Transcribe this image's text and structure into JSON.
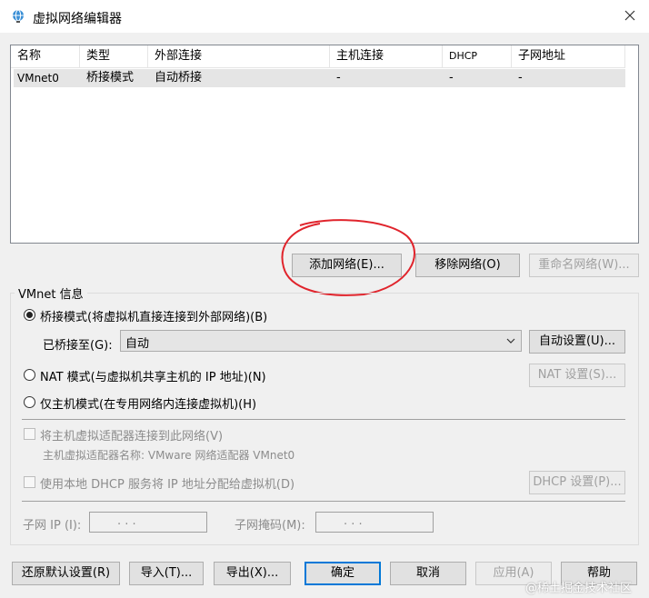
{
  "window": {
    "title": "虚拟网络编辑器"
  },
  "table": {
    "columns": [
      "名称",
      "类型",
      "外部连接",
      "主机连接",
      "DHCP",
      "子网地址"
    ],
    "rows": [
      [
        "VMnet0",
        "桥接模式",
        "自动桥接",
        "-",
        "-",
        "-"
      ]
    ]
  },
  "net_buttons": {
    "add": "添加网络(E)...",
    "remove": "移除网络(O)",
    "rename": "重命名网络(W)..."
  },
  "vmnet_info": {
    "group_label": "VMnet 信息",
    "bridged_label": "桥接模式(将虚拟机直接连接到外部网络)(B)",
    "bridged_to_label": "已桥接至(G):",
    "bridged_to_value": "自动",
    "auto_settings": "自动设置(U)...",
    "nat_label": "NAT 模式(与虚拟机共享主机的 IP 地址)(N)",
    "nat_settings": "NAT 设置(S)...",
    "hostonly_label": "仅主机模式(在专用网络内连接虚拟机)(H)",
    "connect_adapter_label": "将主机虚拟适配器连接到此网络(V)",
    "adapter_name_label": "主机虚拟适配器名称: VMware 网络适配器 VMnet0",
    "dhcp_label": "使用本地 DHCP 服务将 IP 地址分配给虚拟机(D)",
    "dhcp_settings": "DHCP 设置(P)...",
    "subnet_ip_label": "子网 IP (I):",
    "subnet_mask_label": "子网掩码(M):",
    "ip_dots": ".    .    ."
  },
  "footer": {
    "restore": "还原默认设置(R)",
    "import": "导入(T)...",
    "export": "导出(X)...",
    "ok": "确定",
    "cancel": "取消",
    "apply": "应用(A)",
    "help": "帮助"
  },
  "watermark": "@稀土掘金技术社区",
  "colors": {
    "annotation": "#e0242c",
    "selection": "#e5e5e5",
    "accent": "#0078d7"
  }
}
